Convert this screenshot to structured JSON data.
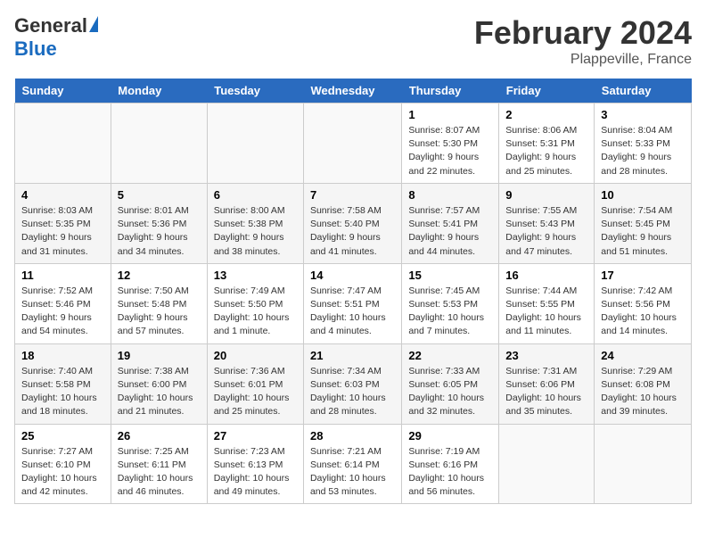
{
  "logo": {
    "general": "General",
    "blue": "Blue"
  },
  "title": {
    "month": "February 2024",
    "location": "Plappeville, France"
  },
  "headers": [
    "Sunday",
    "Monday",
    "Tuesday",
    "Wednesday",
    "Thursday",
    "Friday",
    "Saturday"
  ],
  "weeks": [
    [
      {
        "day": "",
        "sunrise": "",
        "sunset": "",
        "daylight": ""
      },
      {
        "day": "",
        "sunrise": "",
        "sunset": "",
        "daylight": ""
      },
      {
        "day": "",
        "sunrise": "",
        "sunset": "",
        "daylight": ""
      },
      {
        "day": "",
        "sunrise": "",
        "sunset": "",
        "daylight": ""
      },
      {
        "day": "1",
        "sunrise": "Sunrise: 8:07 AM",
        "sunset": "Sunset: 5:30 PM",
        "daylight": "Daylight: 9 hours and 22 minutes."
      },
      {
        "day": "2",
        "sunrise": "Sunrise: 8:06 AM",
        "sunset": "Sunset: 5:31 PM",
        "daylight": "Daylight: 9 hours and 25 minutes."
      },
      {
        "day": "3",
        "sunrise": "Sunrise: 8:04 AM",
        "sunset": "Sunset: 5:33 PM",
        "daylight": "Daylight: 9 hours and 28 minutes."
      }
    ],
    [
      {
        "day": "4",
        "sunrise": "Sunrise: 8:03 AM",
        "sunset": "Sunset: 5:35 PM",
        "daylight": "Daylight: 9 hours and 31 minutes."
      },
      {
        "day": "5",
        "sunrise": "Sunrise: 8:01 AM",
        "sunset": "Sunset: 5:36 PM",
        "daylight": "Daylight: 9 hours and 34 minutes."
      },
      {
        "day": "6",
        "sunrise": "Sunrise: 8:00 AM",
        "sunset": "Sunset: 5:38 PM",
        "daylight": "Daylight: 9 hours and 38 minutes."
      },
      {
        "day": "7",
        "sunrise": "Sunrise: 7:58 AM",
        "sunset": "Sunset: 5:40 PM",
        "daylight": "Daylight: 9 hours and 41 minutes."
      },
      {
        "day": "8",
        "sunrise": "Sunrise: 7:57 AM",
        "sunset": "Sunset: 5:41 PM",
        "daylight": "Daylight: 9 hours and 44 minutes."
      },
      {
        "day": "9",
        "sunrise": "Sunrise: 7:55 AM",
        "sunset": "Sunset: 5:43 PM",
        "daylight": "Daylight: 9 hours and 47 minutes."
      },
      {
        "day": "10",
        "sunrise": "Sunrise: 7:54 AM",
        "sunset": "Sunset: 5:45 PM",
        "daylight": "Daylight: 9 hours and 51 minutes."
      }
    ],
    [
      {
        "day": "11",
        "sunrise": "Sunrise: 7:52 AM",
        "sunset": "Sunset: 5:46 PM",
        "daylight": "Daylight: 9 hours and 54 minutes."
      },
      {
        "day": "12",
        "sunrise": "Sunrise: 7:50 AM",
        "sunset": "Sunset: 5:48 PM",
        "daylight": "Daylight: 9 hours and 57 minutes."
      },
      {
        "day": "13",
        "sunrise": "Sunrise: 7:49 AM",
        "sunset": "Sunset: 5:50 PM",
        "daylight": "Daylight: 10 hours and 1 minute."
      },
      {
        "day": "14",
        "sunrise": "Sunrise: 7:47 AM",
        "sunset": "Sunset: 5:51 PM",
        "daylight": "Daylight: 10 hours and 4 minutes."
      },
      {
        "day": "15",
        "sunrise": "Sunrise: 7:45 AM",
        "sunset": "Sunset: 5:53 PM",
        "daylight": "Daylight: 10 hours and 7 minutes."
      },
      {
        "day": "16",
        "sunrise": "Sunrise: 7:44 AM",
        "sunset": "Sunset: 5:55 PM",
        "daylight": "Daylight: 10 hours and 11 minutes."
      },
      {
        "day": "17",
        "sunrise": "Sunrise: 7:42 AM",
        "sunset": "Sunset: 5:56 PM",
        "daylight": "Daylight: 10 hours and 14 minutes."
      }
    ],
    [
      {
        "day": "18",
        "sunrise": "Sunrise: 7:40 AM",
        "sunset": "Sunset: 5:58 PM",
        "daylight": "Daylight: 10 hours and 18 minutes."
      },
      {
        "day": "19",
        "sunrise": "Sunrise: 7:38 AM",
        "sunset": "Sunset: 6:00 PM",
        "daylight": "Daylight: 10 hours and 21 minutes."
      },
      {
        "day": "20",
        "sunrise": "Sunrise: 7:36 AM",
        "sunset": "Sunset: 6:01 PM",
        "daylight": "Daylight: 10 hours and 25 minutes."
      },
      {
        "day": "21",
        "sunrise": "Sunrise: 7:34 AM",
        "sunset": "Sunset: 6:03 PM",
        "daylight": "Daylight: 10 hours and 28 minutes."
      },
      {
        "day": "22",
        "sunrise": "Sunrise: 7:33 AM",
        "sunset": "Sunset: 6:05 PM",
        "daylight": "Daylight: 10 hours and 32 minutes."
      },
      {
        "day": "23",
        "sunrise": "Sunrise: 7:31 AM",
        "sunset": "Sunset: 6:06 PM",
        "daylight": "Daylight: 10 hours and 35 minutes."
      },
      {
        "day": "24",
        "sunrise": "Sunrise: 7:29 AM",
        "sunset": "Sunset: 6:08 PM",
        "daylight": "Daylight: 10 hours and 39 minutes."
      }
    ],
    [
      {
        "day": "25",
        "sunrise": "Sunrise: 7:27 AM",
        "sunset": "Sunset: 6:10 PM",
        "daylight": "Daylight: 10 hours and 42 minutes."
      },
      {
        "day": "26",
        "sunrise": "Sunrise: 7:25 AM",
        "sunset": "Sunset: 6:11 PM",
        "daylight": "Daylight: 10 hours and 46 minutes."
      },
      {
        "day": "27",
        "sunrise": "Sunrise: 7:23 AM",
        "sunset": "Sunset: 6:13 PM",
        "daylight": "Daylight: 10 hours and 49 minutes."
      },
      {
        "day": "28",
        "sunrise": "Sunrise: 7:21 AM",
        "sunset": "Sunset: 6:14 PM",
        "daylight": "Daylight: 10 hours and 53 minutes."
      },
      {
        "day": "29",
        "sunrise": "Sunrise: 7:19 AM",
        "sunset": "Sunset: 6:16 PM",
        "daylight": "Daylight: 10 hours and 56 minutes."
      },
      {
        "day": "",
        "sunrise": "",
        "sunset": "",
        "daylight": ""
      },
      {
        "day": "",
        "sunrise": "",
        "sunset": "",
        "daylight": ""
      }
    ]
  ]
}
